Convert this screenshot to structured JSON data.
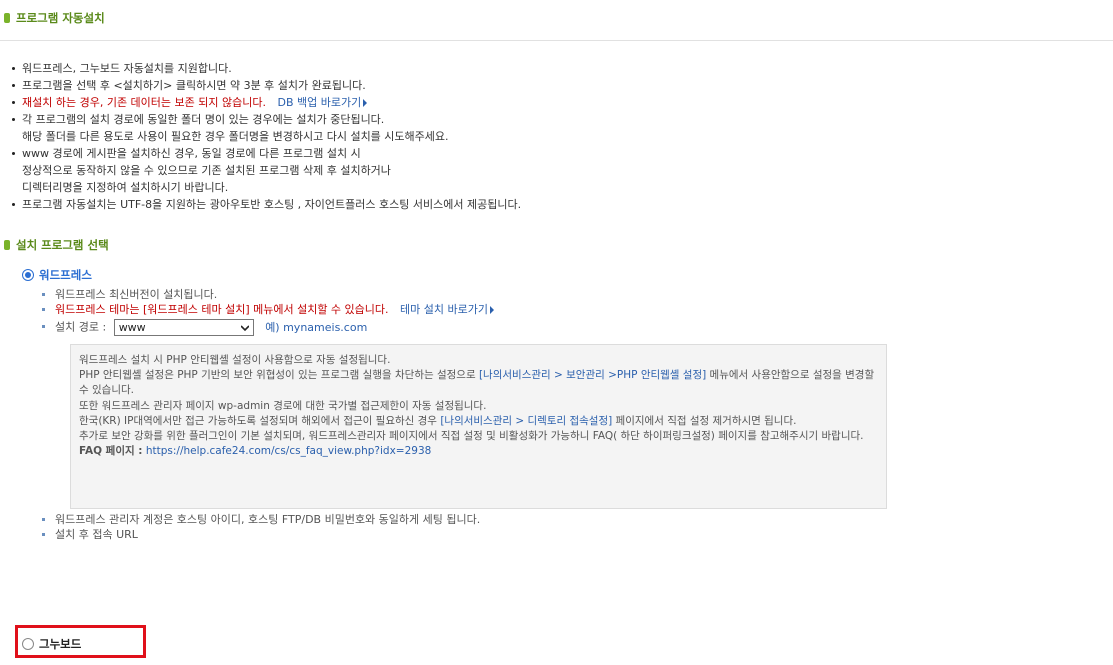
{
  "section1": {
    "title": "프로그램 자동설치"
  },
  "intro": {
    "line1": "워드프레스, 그누보드 자동설치를 지원합니다.",
    "line2": "프로그램을 선택 후 <설치하기> 클릭하시면 약 3분 후 설치가 완료됩니다.",
    "line3_warning": "재설치 하는 경우, 기존 데이터는 보존 되지 않습니다.",
    "line3_link": "DB 백업 바로가기",
    "line4a": "각 프로그램의 설치 경로에 동일한 폴더 명이 있는 경우에는 설치가 중단됩니다.",
    "line4b": "해당 폴더를 다른 용도로 사용이 필요한 경우 폴더명을 변경하시고 다시 설치를 시도해주세요.",
    "line5a": "www 경로에 게시판을 설치하신 경우, 동일 경로에 다른 프로그램 설치 시",
    "line5b": "정상적으로 동작하지 않을 수 있으므로 기존 설치된 프로그램 삭제 후 설치하거나",
    "line5c": "디렉터리명을 지정하여 설치하시기 바랍니다.",
    "line6": "프로그램 자동설치는 UTF-8을 지원하는 광아우토반 호스팅 , 자이언트플러스 호스팅 서비스에서 제공됩니다."
  },
  "section2": {
    "title": "설치 프로그램 선택"
  },
  "wordpress": {
    "label": "워드프레스",
    "item1": "워드프레스 최신버전이 설치됩니다.",
    "item2_warning": "워드프레스 테마는 [워드프레스 테마 설치] 메뉴에서 설치할 수 있습니다.",
    "item2_link": "테마 설치 바로가기",
    "path_label": "설치 경로 :",
    "path_value": "www",
    "path_example": "예) mynameis.com",
    "item4": "워드프레스 관리자 계정은 호스팅 아이디, 호스팅 FTP/DB 비밀번호와 동일하게 세팅 됩니다.",
    "item5": "설치 후 접속 URL"
  },
  "infobox": {
    "p1": "워드프레스 설치 시 PHP 안티웹셸 설정이 사용함으로 자동 설정됩니다.",
    "p2_a": "PHP 안티웹셸 설정은 PHP 기반의 보안 위협성이 있는 프로그램 실행을 차단하는 설정으로 ",
    "p2_link": "[나의서비스관리 > 보안관리 >PHP 안티웹셸 설정]",
    "p2_b": " 메뉴에서 사용안함으로 설정을 변경할 수 있습니다.",
    "p3": "또한 워드프레스 관리자 페이지 wp-admin 경로에 대한 국가별 접근제한이 자동 설정됩니다.",
    "p4_a": "한국(KR) IP대역에서만 접근 가능하도록 설정되며 해외에서 접근이 필요하신 경우 ",
    "p4_link": "[나의서비스관리 > 디렉토리 접속설정]",
    "p4_b": " 페이지에서 직접 설정 제거하시면 됩니다.",
    "p5": "추가로 보안 강화를 위한 플러그인이 기본 설치되며, 워드프레스관리자 페이지에서 직접 설정 및 비활성화가 가능하니 FAQ( 하단 하이퍼링크설정) 페이지를 참고해주시기 바랍니다.",
    "faq_label": "FAQ 페이지 :",
    "faq_url": "https://help.cafe24.com/cs/cs_faq_view.php?idx=2938"
  },
  "gnuboard": {
    "label": "그누보드"
  },
  "colors": {
    "accent_green": "#5a8a1a",
    "warning_red": "#c00000",
    "link_blue": "#2b60ad",
    "highlight_red": "#e0101a"
  }
}
